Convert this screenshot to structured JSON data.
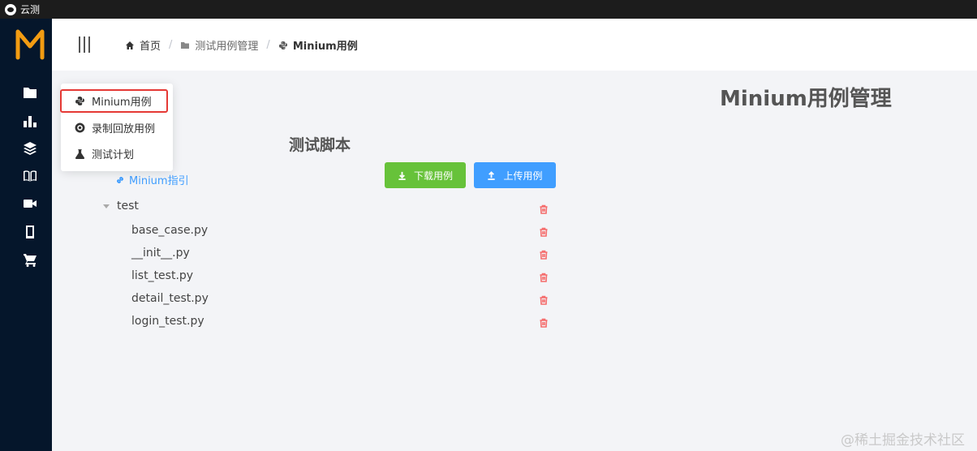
{
  "window": {
    "title": "云测"
  },
  "sidebar": {
    "logo_letter": "M",
    "items": [
      {
        "icon": "folder-icon"
      },
      {
        "icon": "bar-chart-icon"
      },
      {
        "icon": "layers-icon"
      },
      {
        "icon": "book-icon"
      },
      {
        "icon": "video-camera-icon"
      },
      {
        "icon": "mobile-icon"
      },
      {
        "icon": "cart-icon"
      }
    ]
  },
  "breadcrumb": {
    "home": "首页",
    "section": "测试用例管理",
    "current": "Minium用例",
    "separator": "/"
  },
  "page": {
    "title": "Minium用例管理",
    "section_title": "测试脚本",
    "guide_link": "Minium指引",
    "download_button": "下载用例",
    "upload_button": "上传用例"
  },
  "tree": {
    "folder": "test",
    "files": [
      "base_case.py",
      "__init__.py",
      "list_test.py",
      "detail_test.py",
      "login_test.py"
    ]
  },
  "popup_menu": {
    "items": [
      "Minium用例",
      "录制回放用例",
      "测试计划"
    ],
    "highlighted": "Minium用例"
  },
  "watermark": "@稀土掘金技术社区",
  "colors": {
    "sidebar_bg": "#05162b",
    "logo_orange": "#f39c12",
    "download_green": "#67c23a",
    "upload_blue": "#409eff",
    "delete_red": "#f56c6c",
    "highlight_red": "#e53935"
  }
}
